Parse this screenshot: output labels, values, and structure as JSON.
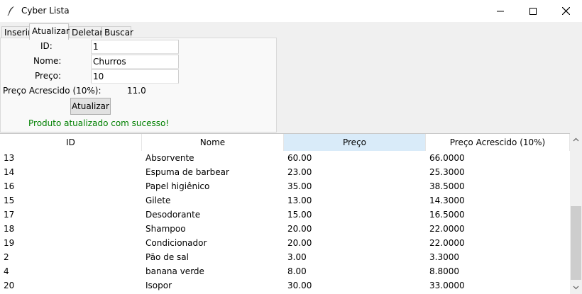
{
  "window": {
    "title": "Cyber Lista",
    "icon": "feather-icon",
    "controls": [
      "minimize-icon",
      "maximize-icon",
      "close-icon"
    ]
  },
  "tabs": [
    {
      "label": "Inserir",
      "active": false
    },
    {
      "label": "Atualizar",
      "active": true
    },
    {
      "label": "Deletar",
      "active": false
    },
    {
      "label": "Buscar",
      "active": false
    }
  ],
  "form": {
    "id_label": "ID:",
    "id_value": "1",
    "nome_label": "Nome:",
    "nome_value": "Churros",
    "preco_label": "Preço:",
    "preco_value": "10",
    "acrescido_label": "Preço Acrescido (10%):",
    "acrescido_value": "11.0",
    "submit_label": "Atualizar",
    "message": "Produto atualizado com sucesso!"
  },
  "colors": {
    "success_text": "#008000",
    "sorted_header": "#d9ebf9"
  },
  "table": {
    "headers": [
      "ID",
      "Nome",
      "Preço",
      "Preço Acrescido (10%)"
    ],
    "sorted_column": "Preço",
    "rows": [
      [
        "13",
        "Absorvente",
        "60.00",
        "66.0000"
      ],
      [
        "14",
        "Espuma de barbear",
        "23.00",
        "25.3000"
      ],
      [
        "16",
        "Papel higiênico",
        "35.00",
        "38.5000"
      ],
      [
        "15",
        "Gilete",
        "13.00",
        "14.3000"
      ],
      [
        "17",
        "Desodorante",
        "15.00",
        "16.5000"
      ],
      [
        "18",
        "Shampoo",
        "20.00",
        "22.0000"
      ],
      [
        "19",
        "Condicionador",
        "20.00",
        "22.0000"
      ],
      [
        "2",
        "Pão de sal",
        "3.00",
        "3.3000"
      ],
      [
        "4",
        "banana verde",
        "8.00",
        "8.8000"
      ],
      [
        "20",
        "Isopor",
        "30.00",
        "33.0000"
      ]
    ]
  }
}
